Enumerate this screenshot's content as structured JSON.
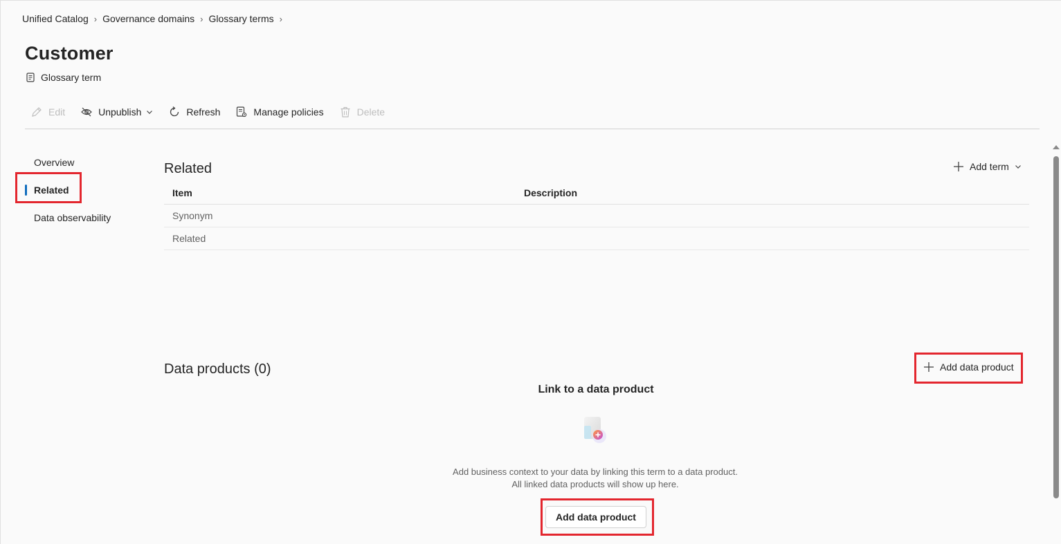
{
  "breadcrumb": [
    "Unified Catalog",
    "Governance domains",
    "Glossary terms"
  ],
  "page": {
    "title": "Customer",
    "subtype": "Glossary term"
  },
  "toolbar": {
    "edit": "Edit",
    "unpublish": "Unpublish",
    "refresh": "Refresh",
    "manage_policies": "Manage policies",
    "delete": "Delete"
  },
  "nav": {
    "items": [
      "Overview",
      "Related",
      "Data observability"
    ],
    "active": "Related"
  },
  "related": {
    "title": "Related",
    "add_term_label": "Add term",
    "columns": [
      "Item",
      "Description"
    ],
    "rows": [
      {
        "item": "Synonym",
        "description": ""
      },
      {
        "item": "Related",
        "description": ""
      }
    ]
  },
  "data_products": {
    "title": "Data products (0)",
    "add_button_label": "Add data product",
    "empty_title": "Link to a data product",
    "empty_line1": "Add business context to your data by linking this term to a data product.",
    "empty_line2": "All linked data products will show up here.",
    "primary_button_label": "Add data product"
  },
  "colors": {
    "accent": "#0f6cbd",
    "highlight": "#e3262e",
    "disabled": "#bdbdbd"
  }
}
